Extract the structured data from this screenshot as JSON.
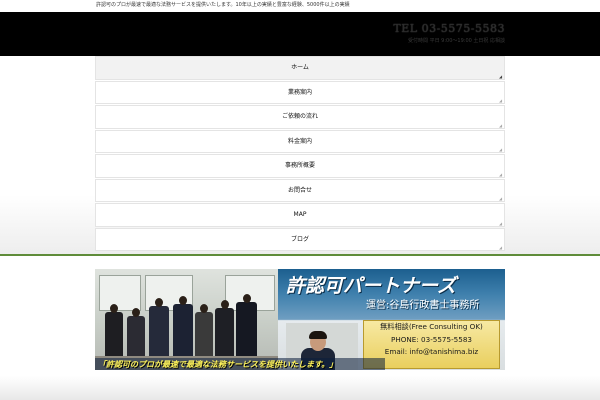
{
  "topbar": {
    "notice": "許認可のプロが最速で最適な法務サービスを提供いたします。10年以上の実績と豊富な経験、5000件以上の実績"
  },
  "header": {
    "tel": "TEL 03-5575-5583",
    "sub": "受付時間 平日 9:00〜19:00 土日祝 応相談"
  },
  "nav": {
    "items": [
      {
        "label": "ホーム",
        "active": true
      },
      {
        "label": "業務案内",
        "active": false
      },
      {
        "label": "ご依頼の流れ",
        "active": false
      },
      {
        "label": "料金案内",
        "active": false
      },
      {
        "label": "事務所概要",
        "active": false
      },
      {
        "label": "お問合せ",
        "active": false
      },
      {
        "label": "MAP",
        "active": false
      },
      {
        "label": "ブログ",
        "active": false
      }
    ]
  },
  "banner": {
    "title": "許認可パートナーズ",
    "operator": "運営:谷島行政書士事務所",
    "consult_line1": "無料相談(Free Consulting OK)",
    "consult_line2": "PHONE: 03-5575-5583",
    "consult_line3": "Email: info@tanishima.biz",
    "slogan": "「許認可のプロが最速で最適な法務サービスを提供いたします。」"
  },
  "colors": {
    "accent_green": "#5f8c3a",
    "header_bg": "#000000",
    "consult_bg": "#e9cf5e"
  }
}
